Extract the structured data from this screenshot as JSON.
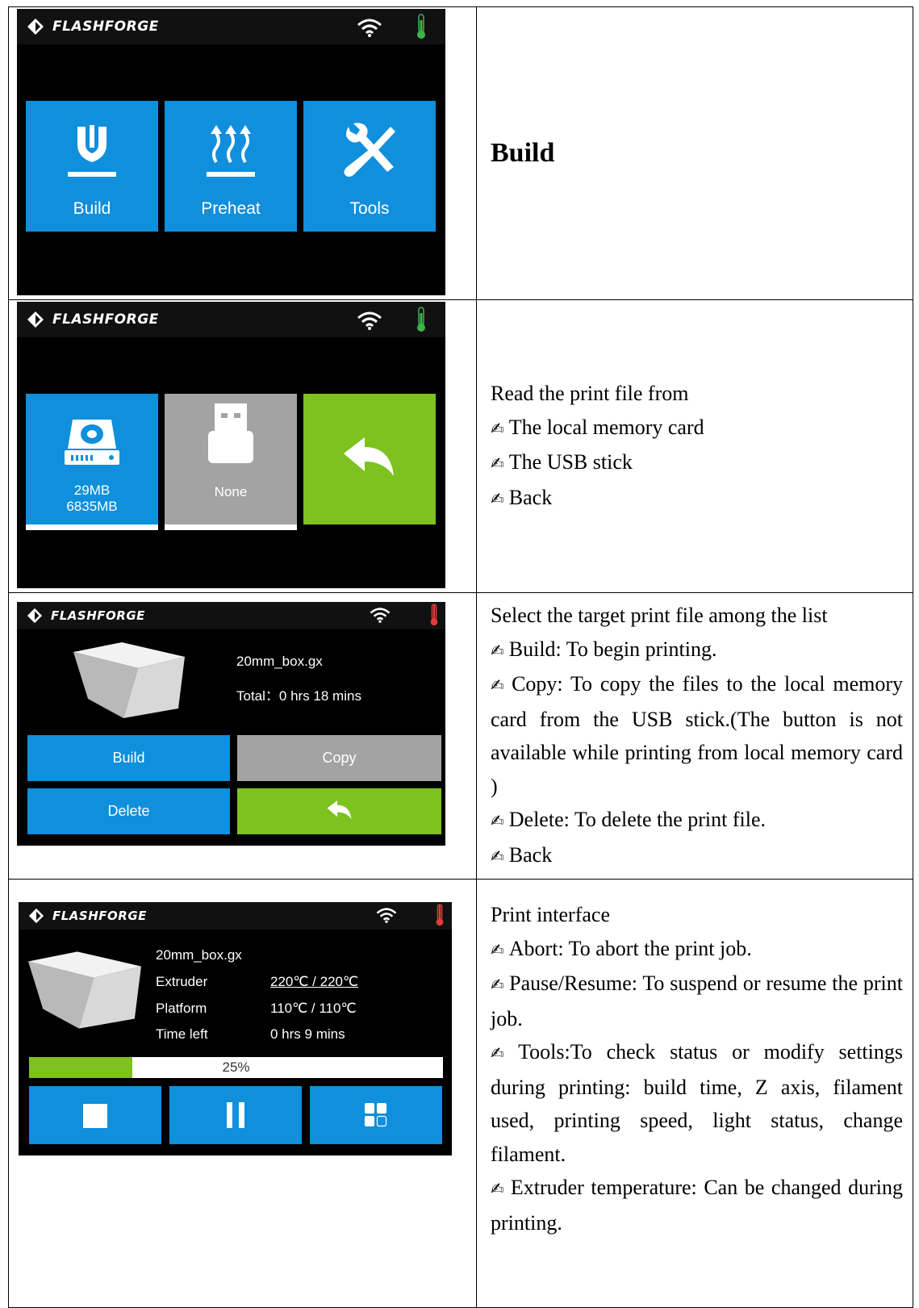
{
  "brand": {
    "name": "FLASHFORGE"
  },
  "colors": {
    "tile_blue": "#0f8fdc",
    "tile_grey": "#a3a3a3",
    "tile_green": "#7dc21e",
    "thermo_green": "#3bb54a",
    "thermo_red": "#e23b3b"
  },
  "rows": [
    {
      "screen": {
        "tiles": [
          "Build",
          "Preheat",
          "Tools"
        ],
        "icons": [
          "nozzle-icon",
          "heat-icon",
          "tools-icon"
        ]
      },
      "desc": {
        "title": "Build"
      }
    },
    {
      "screen": {
        "local": {
          "line1": "29MB",
          "line2": "6835MB"
        },
        "usb": {
          "label": "None"
        },
        "icons": [
          "hard-drive-icon",
          "usb-stick-icon",
          "back-arrow-icon"
        ]
      },
      "desc": {
        "intro": "Read the print file from",
        "items": [
          "The local memory card",
          "The USB stick",
          "Back"
        ]
      }
    },
    {
      "screen": {
        "file_name": "20mm_box.gx",
        "total": "Total：0 hrs 18 mins",
        "buttons": [
          "Build",
          "Copy",
          "Delete"
        ]
      },
      "desc": {
        "intro": "Select the target print file among the list",
        "items": [
          "Build: To begin printing.",
          "Copy: To copy the files to the local memory card from the USB stick.(The button is not available while printing from local memory card )",
          "Delete: To delete the print file.",
          "Back"
        ]
      }
    },
    {
      "screen": {
        "file_name": "20mm_box.gx",
        "labels": [
          "Extruder",
          "Platform",
          "Time left"
        ],
        "values": [
          "220℃ / 220℃",
          "110℃ / 110℃",
          "0 hrs 9 mins"
        ],
        "progress_text": "25%",
        "progress": 0.25
      },
      "desc": {
        "intro": "Print interface",
        "items": [
          "Abort: To abort the print job.",
          "Pause/Resume: To suspend or resume the print job.",
          "Tools:To check status or modify settings during printing: build time, Z axis, filament used, printing speed, light status, change filament.",
          "Extruder temperature: Can be changed during printing."
        ]
      }
    }
  ],
  "bullet": "✍"
}
